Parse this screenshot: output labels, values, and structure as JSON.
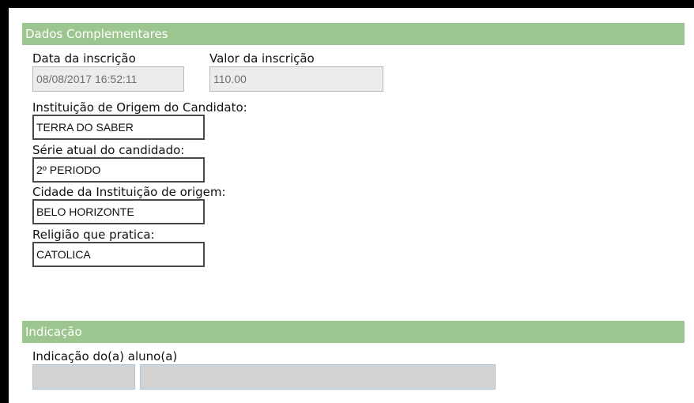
{
  "dados_complementares": {
    "header": "Dados Complementares",
    "data_inscricao_label": "Data da inscrição",
    "data_inscricao_value": "08/08/2017 16:52:11",
    "valor_inscricao_label": "Valor da inscrição",
    "valor_inscricao_value": "110.00",
    "instituicao_label": "Instituição de Origem do Candidato:",
    "instituicao_value": "TERRA DO SABER",
    "serie_label": "Série atual do candidado:",
    "serie_value": "2º PERIODO",
    "cidade_label": "Cidade da Instituição de origem:",
    "cidade_value": "BELO HORIZONTE",
    "religiao_label": "Religião que pratica:",
    "religiao_value": "CATOLICA"
  },
  "indicacao": {
    "header": "Indicação",
    "aluno_label": "Indicação do(a) aluno(a)",
    "aluno_code_value": "",
    "aluno_name_value": ""
  },
  "colors": {
    "section_header_bg": "#9cc58f",
    "section_header_text": "#ffffff",
    "disabled_field_bg": "#ececec",
    "lookup_field_bg": "#d3d3d3"
  }
}
